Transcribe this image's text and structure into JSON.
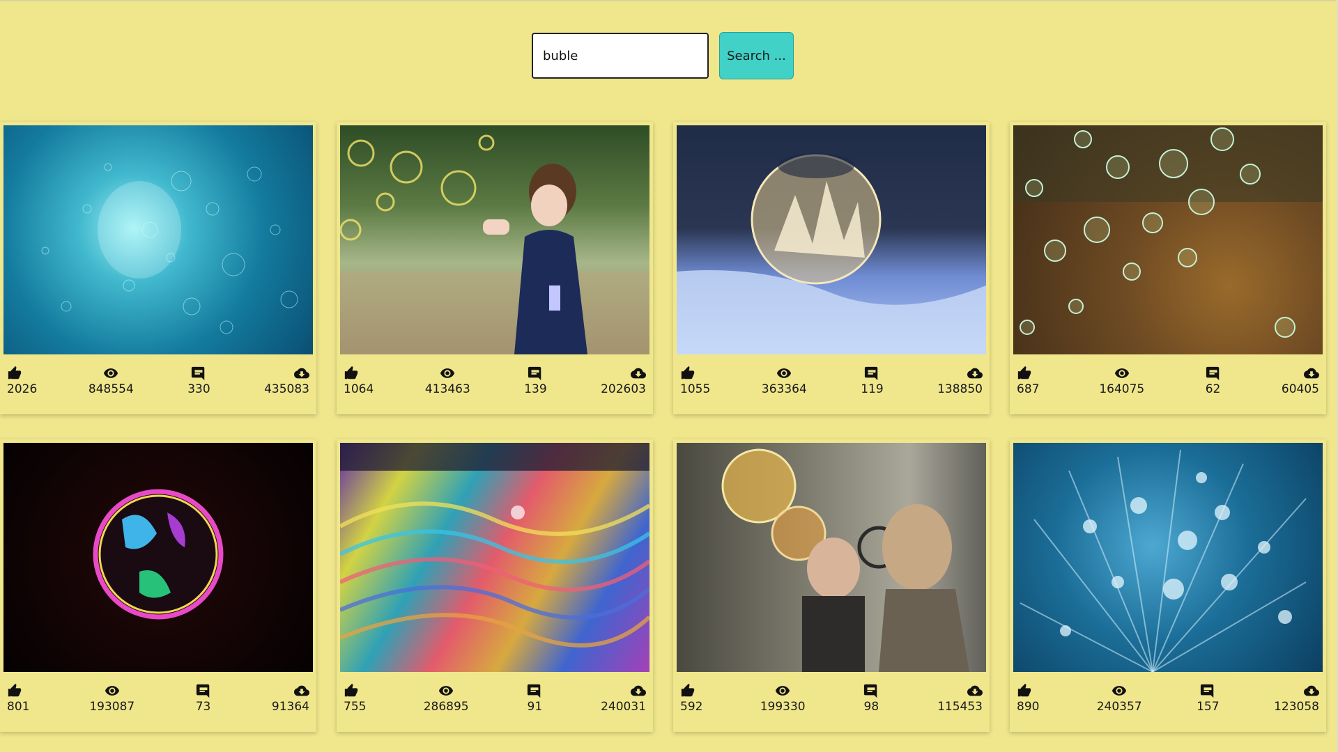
{
  "search": {
    "value": "buble",
    "button_label": "Search ..."
  },
  "colors": {
    "background": "#f0e68c",
    "button": "#41d1c6"
  },
  "icons": {
    "likes": "thumbs-up-icon",
    "views": "eye-icon",
    "comments": "comment-icon",
    "downloads": "cloud-download-icon"
  },
  "cards": [
    {
      "likes": "2026",
      "views": "848554",
      "comments": "330",
      "downloads": "435083"
    },
    {
      "likes": "1064",
      "views": "413463",
      "comments": "139",
      "downloads": "202603"
    },
    {
      "likes": "1055",
      "views": "363364",
      "comments": "119",
      "downloads": "138850"
    },
    {
      "likes": "687",
      "views": "164075",
      "comments": "62",
      "downloads": "60405"
    },
    {
      "likes": "801",
      "views": "193087",
      "comments": "73",
      "downloads": "91364"
    },
    {
      "likes": "755",
      "views": "286895",
      "comments": "91",
      "downloads": "240031"
    },
    {
      "likes": "592",
      "views": "199330",
      "comments": "98",
      "downloads": "115453"
    },
    {
      "likes": "890",
      "views": "240357",
      "comments": "157",
      "downloads": "123058"
    }
  ]
}
